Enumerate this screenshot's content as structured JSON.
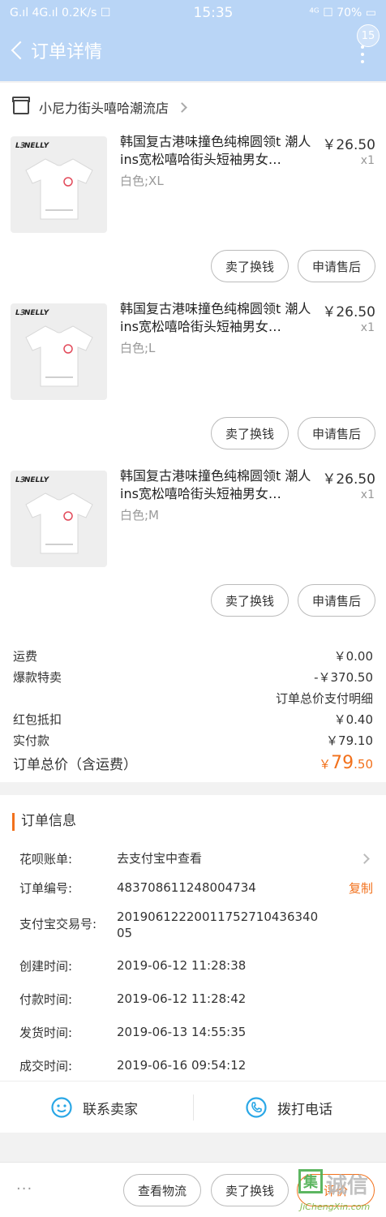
{
  "status_bar": {
    "left": "G.ıl 4G.ıl 0.2K/s ☐",
    "time": "15:35",
    "right": "⁴ᴳ ☐ 70% ▭"
  },
  "nav": {
    "title": "订单详情",
    "badge": "15"
  },
  "shop": {
    "name": "小尼力街头嘻哈潮流店"
  },
  "items": [
    {
      "brand": "ԼꞫNELLY",
      "title": "韩国复古港味撞色纯棉圆领t 潮人ins宽松嘻哈街头短袖男女…",
      "sku": "白色;XL",
      "price": "￥26.50",
      "qty": "x1",
      "sell_label": "卖了换钱",
      "service_label": "申请售后"
    },
    {
      "brand": "ԼꞫNELLY",
      "title": "韩国复古港味撞色纯棉圆领t 潮人ins宽松嘻哈街头短袖男女…",
      "sku": "白色;L",
      "price": "￥26.50",
      "qty": "x1",
      "sell_label": "卖了换钱",
      "service_label": "申请售后"
    },
    {
      "brand": "ԼꞫNELLY",
      "title": "韩国复古港味撞色纯棉圆领t 潮人ins宽松嘻哈街头短袖男女…",
      "sku": "白色;M",
      "price": "￥26.50",
      "qty": "x1",
      "sell_label": "卖了换钱",
      "service_label": "申请售后"
    }
  ],
  "costs": {
    "shipping_label": "运费",
    "shipping_value": "￥0.00",
    "promo_label": "爆款特卖",
    "promo_value": "-￥370.50",
    "detail_link": "订单总价支付明细",
    "redpacket_label": "红包抵扣",
    "redpacket_value": "￥0.40",
    "paid_label": "实付款",
    "paid_value": "￥79.10",
    "total_label": "订单总价（含运费）",
    "total_currency": "￥",
    "total_int": "79",
    "total_dec": ".50"
  },
  "order_info": {
    "heading": "订单信息",
    "rows": [
      {
        "key": "花呗账单:",
        "value": "去支付宝中查看"
      },
      {
        "key": "订单编号:",
        "value": "483708611248004734"
      },
      {
        "key": "支付宝交易号:",
        "value": "20190612220011752710436340 05"
      },
      {
        "key": "创建时间:",
        "value": "2019-06-12 11:28:38"
      },
      {
        "key": "付款时间:",
        "value": "2019-06-12 11:28:42"
      },
      {
        "key": "发货时间:",
        "value": "2019-06-13 14:55:35"
      },
      {
        "key": "成交时间:",
        "value": "2019-06-16 09:54:12"
      }
    ],
    "copy_label": "复制"
  },
  "contact": {
    "seller_label": "联系卖家",
    "phone_label": "拨打电话"
  },
  "bottom": {
    "more_label": "···",
    "logistics_label": "查看物流",
    "sell_label": "卖了换钱",
    "review_label": "评价"
  },
  "watermark": {
    "box": "集",
    "text": "诚信",
    "url": "JiChengXin.com"
  },
  "colors": {
    "header": "#b9d5f6",
    "accent": "#f2711c",
    "icon_blue": "#2aa7e6"
  }
}
